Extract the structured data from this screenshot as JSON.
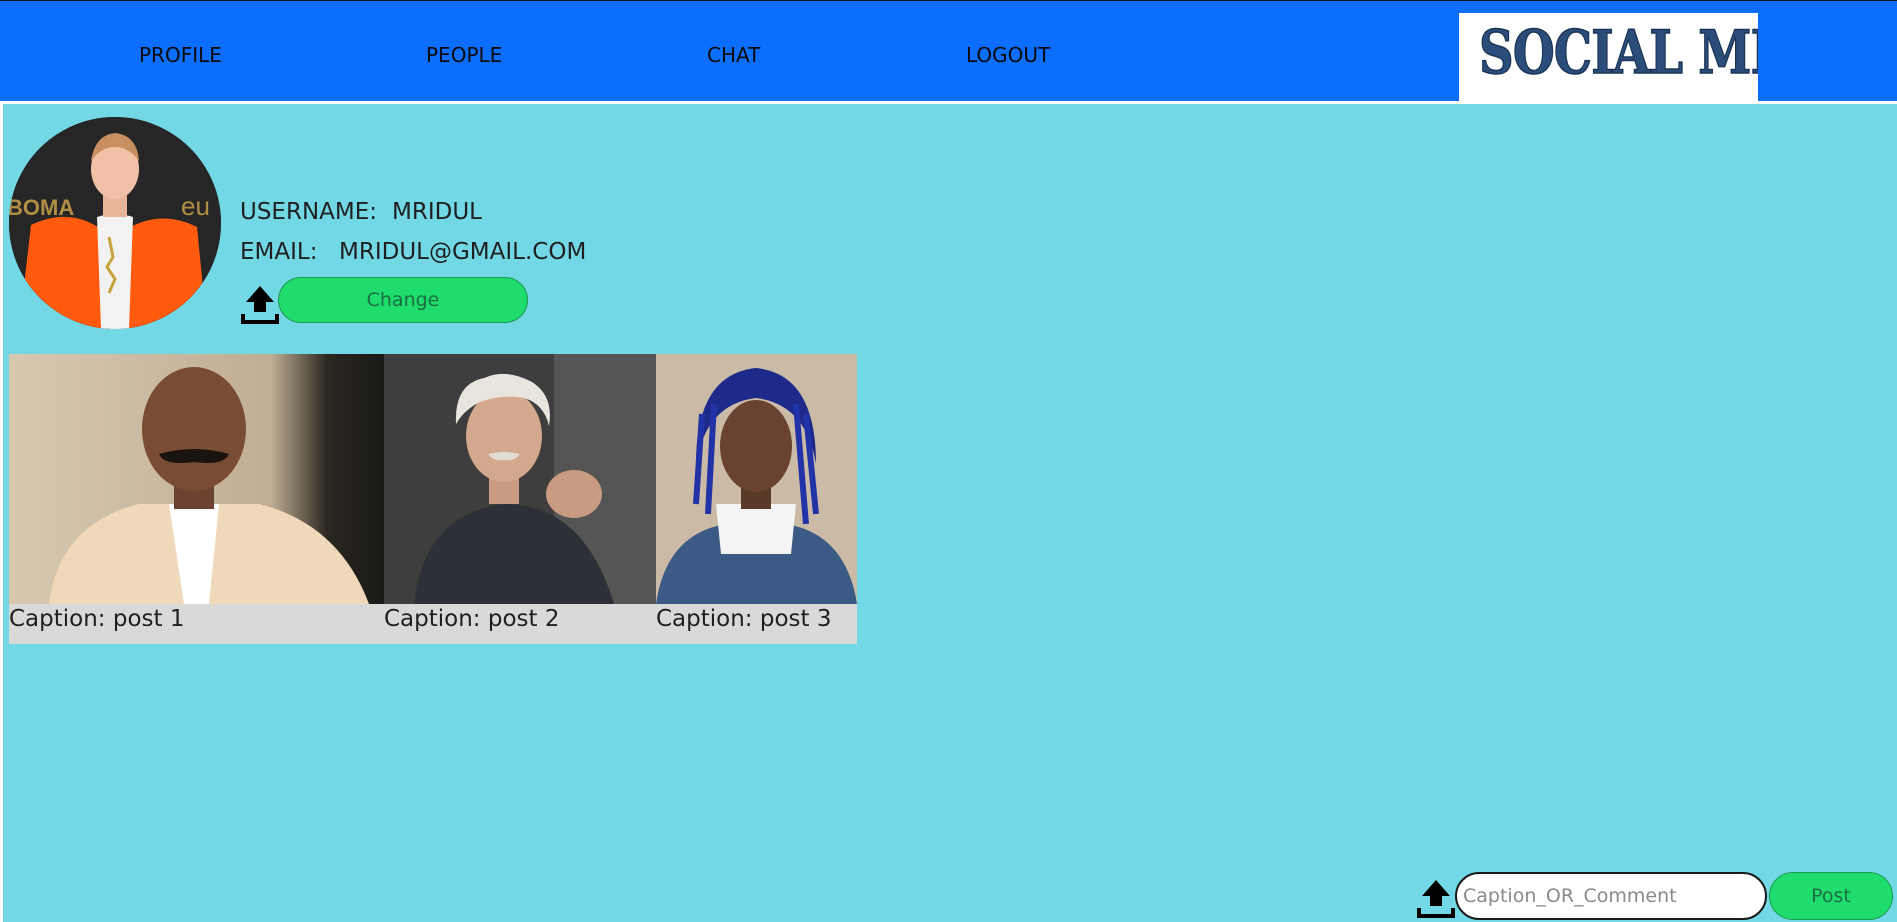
{
  "nav": {
    "items": [
      {
        "label": "PROFILE"
      },
      {
        "label": "PEOPLE"
      },
      {
        "label": "CHAT"
      },
      {
        "label": "LOGOUT"
      }
    ],
    "logo_text": "SOCIAL MED",
    "bar_color": "#0d6efd"
  },
  "profile": {
    "username_label": "USERNAME:",
    "username": "MRIDUL",
    "email_label": "EMAIL:",
    "email": "MRIDUL@GMAIL.COM",
    "upload_icon": "upload-icon",
    "change_label": "Change"
  },
  "posts": [
    {
      "caption": "Caption: post 1"
    },
    {
      "caption": "Caption: post 2"
    },
    {
      "caption": "Caption: post 3"
    }
  ],
  "composer": {
    "upload_icon": "upload-icon",
    "placeholder": "Caption_OR_Comment",
    "value": "",
    "post_label": "Post"
  },
  "colors": {
    "page_bg": "#73d8e6",
    "button_green": "#1fdd6d",
    "caption_bar": "#d9d9d9"
  }
}
